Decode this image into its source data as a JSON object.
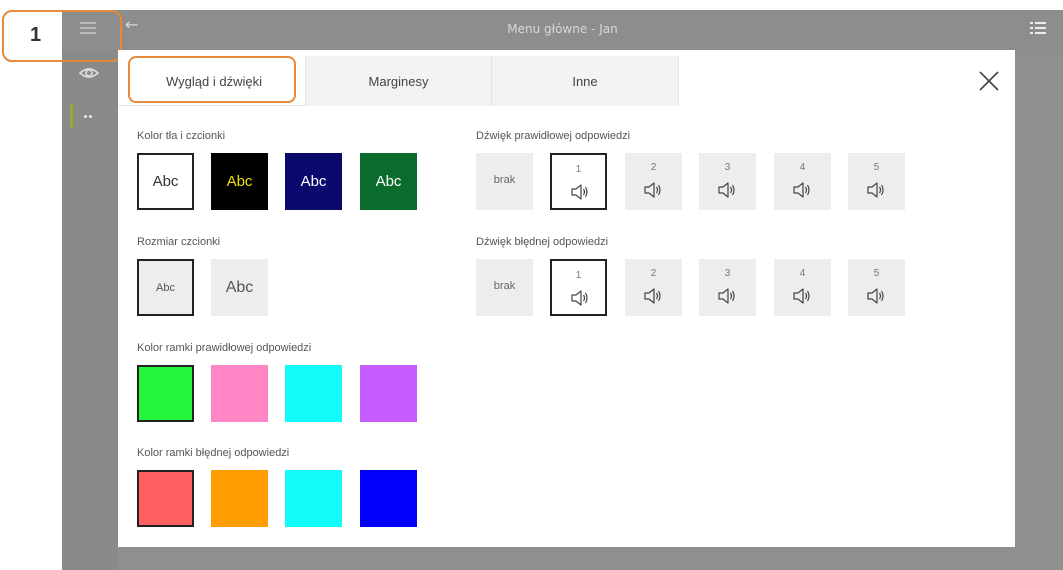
{
  "app": {
    "window_title": "Menu główne - Jan",
    "callout_number": "1"
  },
  "tabs": [
    {
      "label": "Wygląd i dźwięki",
      "active": true
    },
    {
      "label": "Marginesy",
      "active": false
    },
    {
      "label": "Inne",
      "active": false
    }
  ],
  "sections": {
    "bg_font_color": {
      "label": "Kolor tła i czcionki",
      "options": [
        {
          "text": "Abc",
          "bg": "#ffffff",
          "fg": "#333333",
          "selected": true
        },
        {
          "text": "Abc",
          "bg": "#000000",
          "fg": "#f0e000",
          "selected": false
        },
        {
          "text": "Abc",
          "bg": "#0a0a6e",
          "fg": "#ffffff",
          "selected": false
        },
        {
          "text": "Abc",
          "bg": "#0b6b2c",
          "fg": "#ffffff",
          "selected": false
        }
      ]
    },
    "font_size": {
      "label": "Rozmiar czcionki",
      "options": [
        {
          "text": "Abc",
          "selected": true
        },
        {
          "text": "Abc",
          "selected": false
        }
      ]
    },
    "correct_frame_color": {
      "label": "Kolor ramki prawidłowej odpowiedzi",
      "colors": [
        "#22f53a",
        "#ff85c4",
        "#14fbfb",
        "#c65cff"
      ],
      "selected_index": 0
    },
    "wrong_frame_color": {
      "label": "Kolor ramki błędnej odpowiedzi",
      "colors": [
        "#ff5f5f",
        "#ff9d00",
        "#14fbfb",
        "#0000fb"
      ],
      "selected_index": 0
    },
    "correct_sound": {
      "label": "Dźwięk prawidłowej odpowiedzi",
      "none_label": "brak",
      "options": [
        "1",
        "2",
        "3",
        "4",
        "5"
      ],
      "selected": "1"
    },
    "wrong_sound": {
      "label": "Dźwięk błędnej odpowiedzi",
      "none_label": "brak",
      "options": [
        "1",
        "2",
        "3",
        "4",
        "5"
      ],
      "selected": "1"
    }
  },
  "icons": {
    "menu": "hamburger-icon",
    "back": "back-arrow-icon",
    "list": "list-icon",
    "view": "eye-icon",
    "close": "close-icon",
    "sound": "speaker-icon"
  },
  "colors": {
    "accent_callout": "#e58a3a",
    "nav_active": "#8fae2e",
    "overlay_gray": "#8f8f8f"
  }
}
